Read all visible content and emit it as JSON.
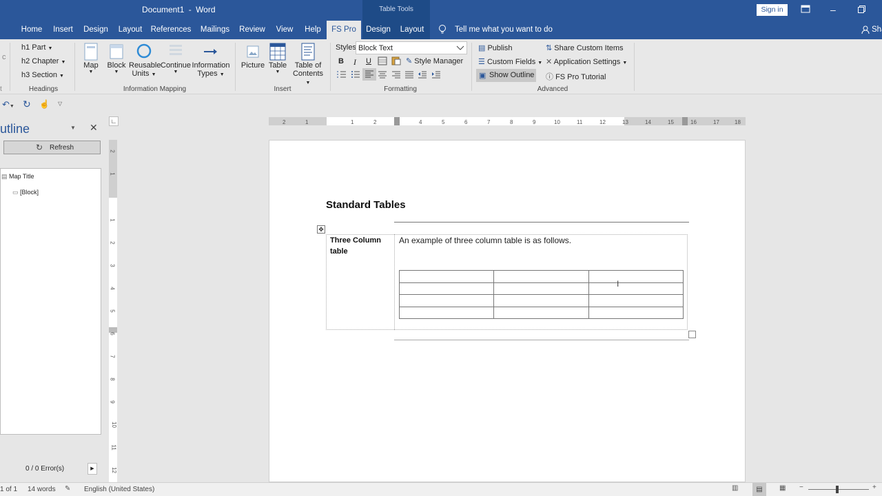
{
  "app": {
    "document_title": "Document1",
    "separator": "-",
    "app_name": "Word",
    "context_label": "Table Tools",
    "sign_in": "Sign in",
    "share": "Sha"
  },
  "tabs": [
    "Home",
    "Insert",
    "Design",
    "Layout",
    "References",
    "Mailings",
    "Review",
    "View",
    "Help",
    "FS Pro",
    "Design",
    "Layout"
  ],
  "tell_me": "Tell me what you want to do",
  "ribbon": {
    "headings": {
      "items": [
        "h1 Part",
        "h2 Chapter",
        "h3 Section"
      ],
      "label": "Headings"
    },
    "info_mapping": {
      "map": "Map",
      "block": "Block",
      "reusable1": "Reusable",
      "reusable2": "Units",
      "continue": "Continue",
      "infotypes1": "Information",
      "infotypes2": "Types",
      "label": "Information Mapping"
    },
    "insert": {
      "picture": "Picture",
      "table": "Table",
      "toc1": "Table of",
      "toc2": "Contents",
      "label": "Insert"
    },
    "formatting": {
      "styles_label": "Styles",
      "styles_value": "Block Text",
      "bold": "B",
      "italic": "I",
      "underline": "U",
      "style_manager": "Style Manager",
      "label": "Formatting"
    },
    "advanced": {
      "publish": "Publish",
      "custom_fields": "Custom Fields",
      "show_outline": "Show Outline",
      "share_custom": "Share Custom Items",
      "app_settings": "Application Settings",
      "tutorial": "FS Pro Tutorial",
      "label": "Advanced"
    }
  },
  "nav": {
    "title": "utline",
    "refresh": "Refresh",
    "tree": [
      "Map Title",
      "[Block]"
    ],
    "errors": "0 / 0  Error(s)"
  },
  "ruler": {
    "h": [
      "2",
      "1",
      "1",
      "2",
      "3",
      "4",
      "5",
      "6",
      "7",
      "8",
      "9",
      "10",
      "11",
      "12",
      "13",
      "14",
      "15",
      "16",
      "17",
      "18"
    ],
    "v": [
      "2",
      "1",
      "1",
      "2",
      "3",
      "4",
      "5",
      "6",
      "7",
      "8",
      "9",
      "10",
      "11",
      "12"
    ]
  },
  "document": {
    "heading": "Standard Tables",
    "block_label": "Three Column table",
    "block_text": "An example of three column table is as follows.",
    "table_rows": 4,
    "table_cols": 3
  },
  "status": {
    "page": "1 of 1",
    "words": "14 words",
    "language": "English (United States)"
  }
}
